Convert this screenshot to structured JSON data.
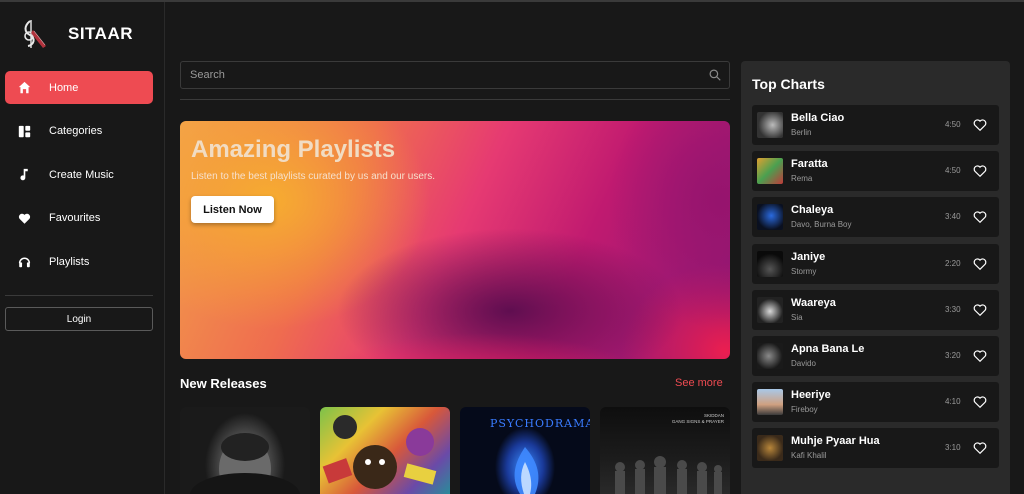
{
  "app": {
    "name": "SITAAR"
  },
  "sidebar": {
    "items": [
      {
        "label": "Home",
        "icon": "home-icon",
        "active": true
      },
      {
        "label": "Categories",
        "icon": "categories-icon",
        "active": false
      },
      {
        "label": "Create Music",
        "icon": "music-note-icon",
        "active": false
      },
      {
        "label": "Favourites",
        "icon": "heart-icon",
        "active": false
      },
      {
        "label": "Playlists",
        "icon": "headphones-icon",
        "active": false
      }
    ],
    "login_label": "Login"
  },
  "search": {
    "placeholder": "Search"
  },
  "hero": {
    "title": "Amazing Playlists",
    "subtitle": "Listen to the best playlists curated by us and our users.",
    "button_label": "Listen Now"
  },
  "new_releases": {
    "title": "New Releases",
    "see_more": "See more",
    "cover_texts": {
      "third": "PSYCHODRAMA",
      "fourth_line1": "SKIDDAN",
      "fourth_line2": "GANG SIGNS & PRAYER"
    }
  },
  "top_charts": {
    "title": "Top Charts",
    "songs": [
      {
        "title": "Bella Ciao",
        "artist": "Berlin",
        "duration": "4:50"
      },
      {
        "title": "Faratta",
        "artist": "Rema",
        "duration": "4:50"
      },
      {
        "title": "Chaleya",
        "artist": "Davo, Burna Boy",
        "duration": "3:40"
      },
      {
        "title": "Janiye",
        "artist": "Stormy",
        "duration": "2:20"
      },
      {
        "title": "Waareya",
        "artist": "Sia",
        "duration": "3:30"
      },
      {
        "title": "Apna Bana Le",
        "artist": "Davido",
        "duration": "3:20"
      },
      {
        "title": "Heeriye",
        "artist": "Fireboy",
        "duration": "4:10"
      },
      {
        "title": "Muhje Pyaar Hua",
        "artist": "Kafi Khalil",
        "duration": "3:10"
      }
    ]
  },
  "colors": {
    "accent": "#ee4b52",
    "background": "#181818",
    "panel": "#2a2a2a"
  }
}
